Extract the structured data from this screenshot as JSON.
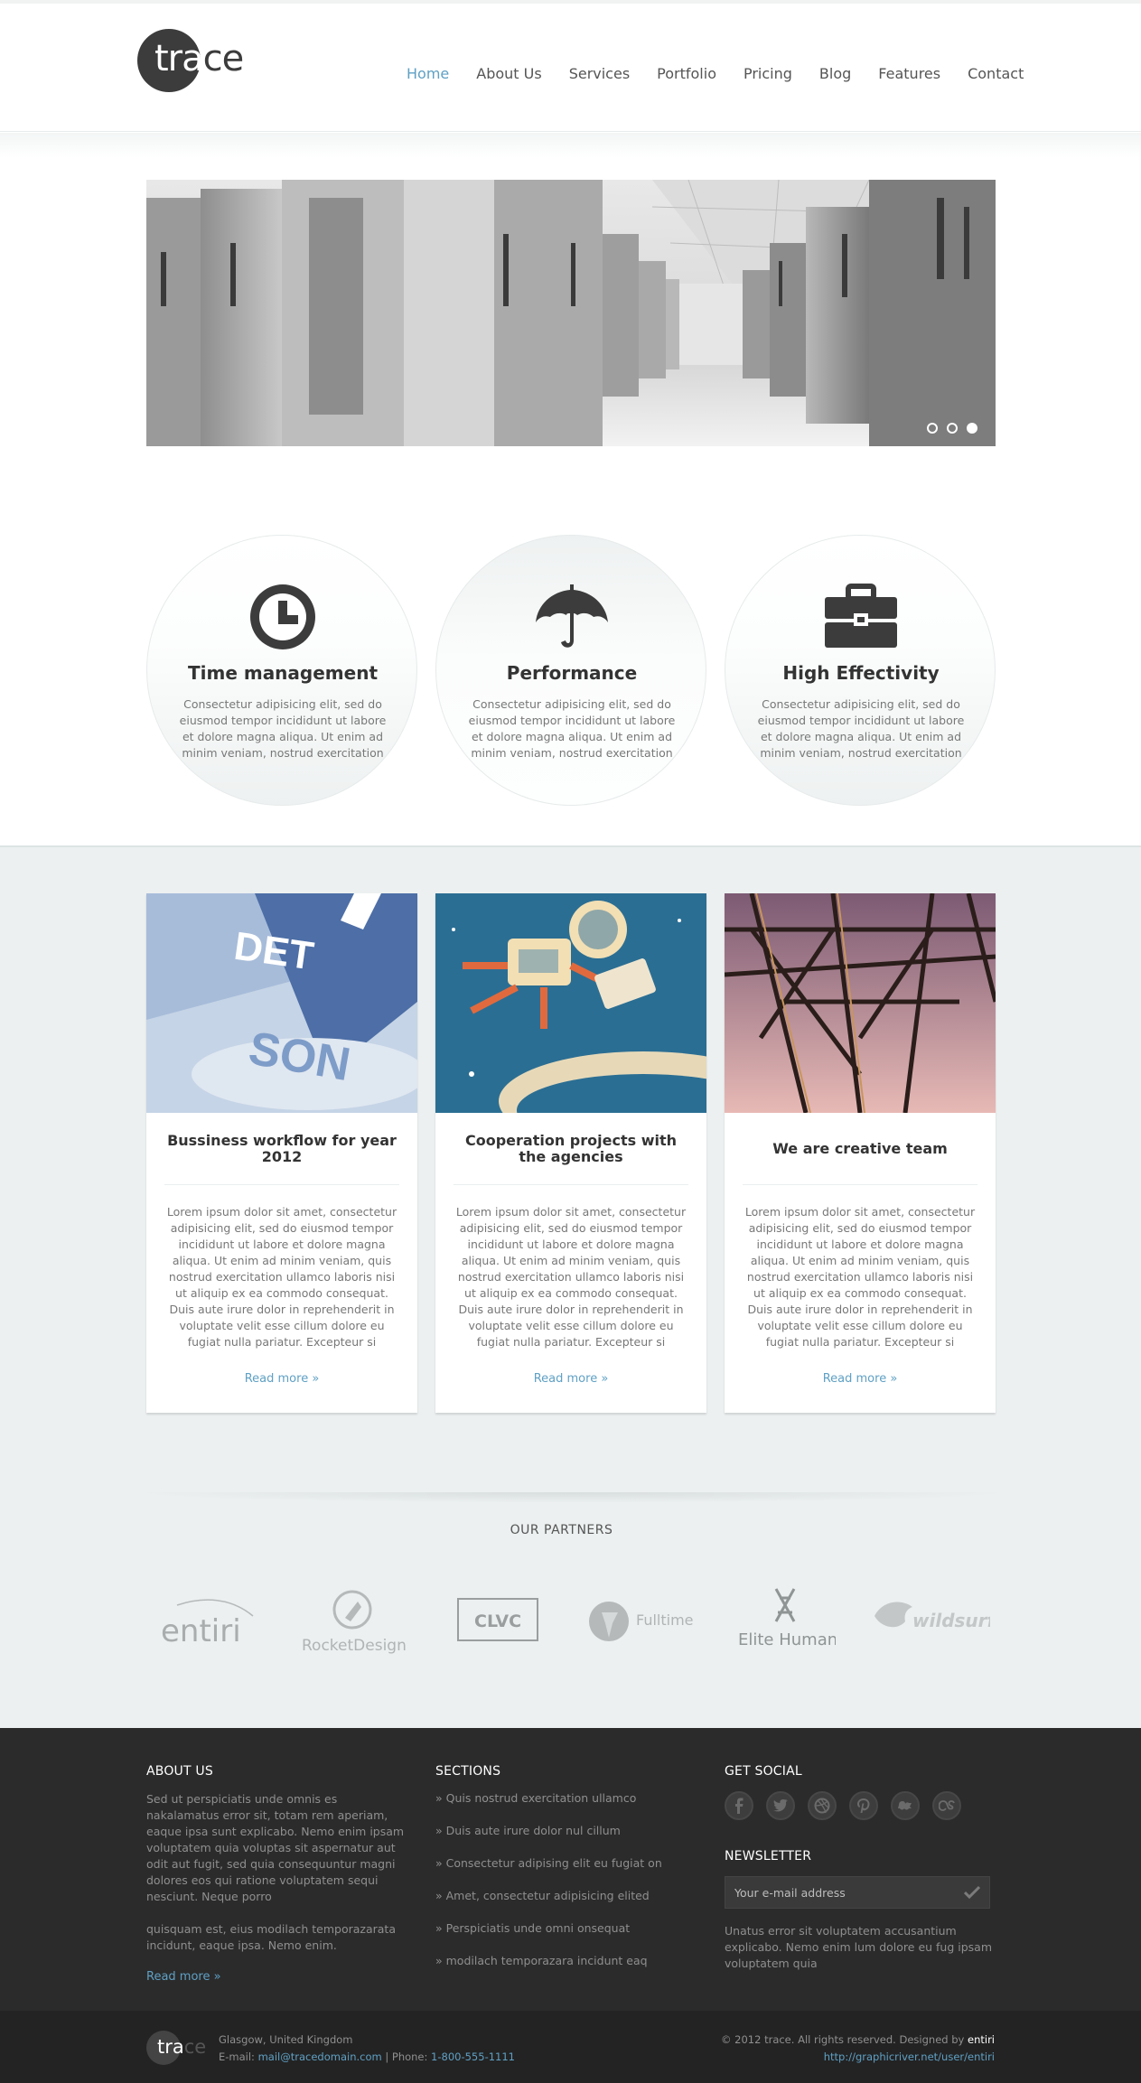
{
  "header": {
    "logo": {
      "part_white": "tra",
      "part_dark": "ce"
    },
    "nav": [
      "Home",
      "About Us",
      "Services",
      "Portfolio",
      "Pricing",
      "Blog",
      "Features",
      "Contact"
    ],
    "active_nav": "Home"
  },
  "slider": {
    "slide_count": 3,
    "active_slide": 3
  },
  "features": [
    {
      "icon": "clock-icon",
      "title": "Time management",
      "text": "Consectetur adipisicing elit, sed do eiusmod tempor incididunt ut labore et dolore magna aliqua. Ut enim ad minim veniam, nostrud exercitation"
    },
    {
      "icon": "umbrella-icon",
      "title": "Performance",
      "text": "Consectetur adipisicing elit, sed do eiusmod tempor incididunt ut labore et dolore magna aliqua. Ut enim ad minim veniam, nostrud exercitation"
    },
    {
      "icon": "briefcase-icon",
      "title": "High Effectivity",
      "text": "Consectetur adipisicing elit, sed do eiusmod tempor incididunt ut labore et dolore magna aliqua. Ut enim ad minim veniam, nostrud exercitation"
    }
  ],
  "cards": [
    {
      "title": "Bussiness workflow for year 2012",
      "text": "Lorem ipsum dolor sit amet, consectetur adipisicing elit, sed do eiusmod tempor incididunt ut labore et dolore magna aliqua. Ut enim ad minim veniam, quis nostrud exercitation ullamco laboris nisi ut aliquip ex ea commodo consequat. Duis aute irure dolor in reprehenderit in voluptate velit esse cillum dolore eu fugiat nulla pariatur. Excepteur si",
      "more": "Read more »"
    },
    {
      "title": "Cooperation projects with the agencies",
      "text": "Lorem ipsum dolor sit amet, consectetur adipisicing elit, sed do eiusmod tempor incididunt ut labore et dolore magna aliqua. Ut enim ad minim veniam, quis nostrud exercitation ullamco laboris nisi ut aliquip ex ea commodo consequat. Duis aute irure dolor in reprehenderit in voluptate velit esse cillum dolore eu fugiat nulla pariatur. Excepteur si",
      "more": "Read more »"
    },
    {
      "title": "We are creative team",
      "text": "Lorem ipsum dolor sit amet, consectetur adipisicing elit, sed do eiusmod tempor incididunt ut labore et dolore magna aliqua. Ut enim ad minim veniam, quis nostrud exercitation ullamco laboris nisi ut aliquip ex ea commodo consequat. Duis aute irure dolor in reprehenderit in voluptate velit esse cillum dolore eu fugiat nulla pariatur. Excepteur si",
      "more": "Read more »"
    }
  ],
  "partners": {
    "title": "OUR PARTNERS",
    "logos": [
      "entiri",
      "RocketDesign",
      "CLVC",
      "Fulltime",
      "Elite Human",
      "wildsurf"
    ]
  },
  "footer": {
    "about": {
      "title": "ABOUT US",
      "p1": "Sed ut perspiciatis unde omnis es nakalamatus error sit, totam rem aperiam, eaque ipsa sunt explicabo. Nemo enim ipsam voluptatem quia voluptas sit aspernatur aut odit aut fugit, sed quia consequuntur magni dolores eos qui ratione voluptatem sequi nesciunt. Neque porro",
      "p2": "quisquam est, eius modilach temporazarata incidunt, eaque ipsa. Nemo enim.",
      "more": "Read more »"
    },
    "sections": {
      "title": "SECTIONS",
      "items": [
        "» Quis nostrud exercitation ullamco",
        "» Duis aute irure dolor nul cillum",
        "» Consectetur adipising elit eu fugiat on",
        "» Amet, consectetur adipisicing elited",
        "» Perspiciatis unde omni onsequat",
        "» modilach temporazara incidunt eaq"
      ]
    },
    "social": {
      "title": "GET SOCIAL",
      "icons": [
        "facebook-icon",
        "twitter-icon",
        "dribbble-icon",
        "pinterest-icon",
        "delicious-icon",
        "lastfm-icon"
      ]
    },
    "newsletter": {
      "title": "NEWSLETTER",
      "placeholder": "Your e-mail address",
      "text": "Unatus error sit voluptatem accusantium explicabo. Nemo enim lum dolore eu fug ipsam voluptatem quia"
    }
  },
  "bottom": {
    "location": "Glasgow, United Kingdom",
    "email_label": "E-mail:",
    "email": "mail@tracedomain.com",
    "phone_label": "| Phone:",
    "phone": "1-800-555-1111",
    "copyright": "© 2012 trace. All rights reserved. Designed by",
    "designer": "entiri",
    "url": "http://graphicriver.net/user/entiri"
  }
}
